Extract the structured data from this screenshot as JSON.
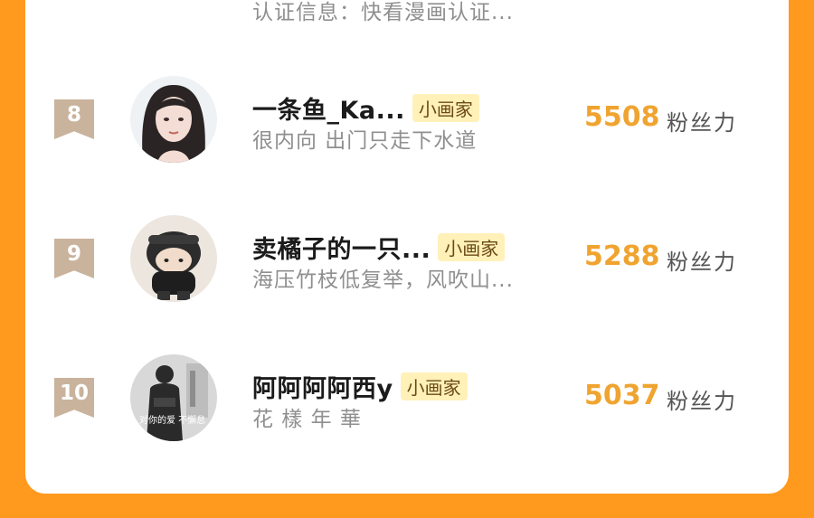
{
  "partial_row": {
    "bio": "认证信息：快看漫画认证..."
  },
  "rows": [
    {
      "rank": "8",
      "name": "一条鱼_Ka...",
      "tag": "小画家",
      "bio": "很内向 出门只走下水道",
      "score": "5508",
      "score_label": "粉丝力"
    },
    {
      "rank": "9",
      "name": "卖橘子的一只...",
      "tag": "小画家",
      "bio": "海压竹枝低复举，风吹山...",
      "score": "5288",
      "score_label": "粉丝力"
    },
    {
      "rank": "10",
      "name": "阿阿阿阿西y",
      "tag": "小画家",
      "bio": "花 樣 年 華",
      "score": "5037",
      "score_label": "粉丝力"
    }
  ],
  "avatar_caption": "对你的爱 不懈怠",
  "colors": {
    "background": "#ff9a1f",
    "score": "#f0a430",
    "tag_bg": "#fff1b8",
    "badge": "#c9b39c"
  }
}
